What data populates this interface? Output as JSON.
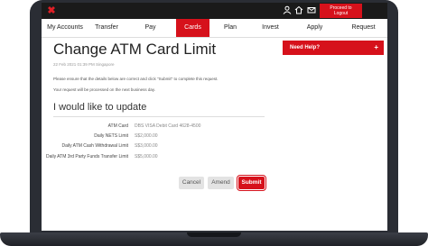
{
  "topbar": {
    "logo_icon": "dbs-logo-icon",
    "logout_label_line1": "Proceed to",
    "logout_label_line2": "Logout",
    "icons": [
      "user-icon",
      "home-icon",
      "mail-icon"
    ]
  },
  "nav": {
    "items": [
      "My Accounts",
      "Transfer",
      "Pay",
      "Cards",
      "Plan",
      "Invest",
      "Apply",
      "Request"
    ],
    "active": "Cards"
  },
  "page": {
    "title": "Change ATM Card Limit",
    "timestamp": "22 Feb 2021 01:39 PM Singapore",
    "instruction": "Please ensure that the details below are correct and click \"Submit\" to complete this request.",
    "processing_note": "Your request will be processed on the next business day.",
    "section_title": "I would like to update"
  },
  "details": [
    {
      "label": "ATM Card",
      "value": "DBS VISA Debit Card 4628-4500"
    },
    {
      "label": "Daily NETS Limit",
      "value": "S$2,000.00"
    },
    {
      "label": "Daily ATM Cash Withdrawal Limit",
      "value": "S$3,000.00"
    },
    {
      "label": "Daily ATM 3rd Party Funds Transfer Limit",
      "value": "S$5,000.00"
    }
  ],
  "actions": {
    "cancel": "Cancel",
    "amend": "Amend",
    "submit": "Submit"
  },
  "help": {
    "label": "Need Help?",
    "expand_icon": "plus-icon"
  },
  "colors": {
    "brand_red": "#d6111b",
    "topbar": "#1a1a1a"
  }
}
